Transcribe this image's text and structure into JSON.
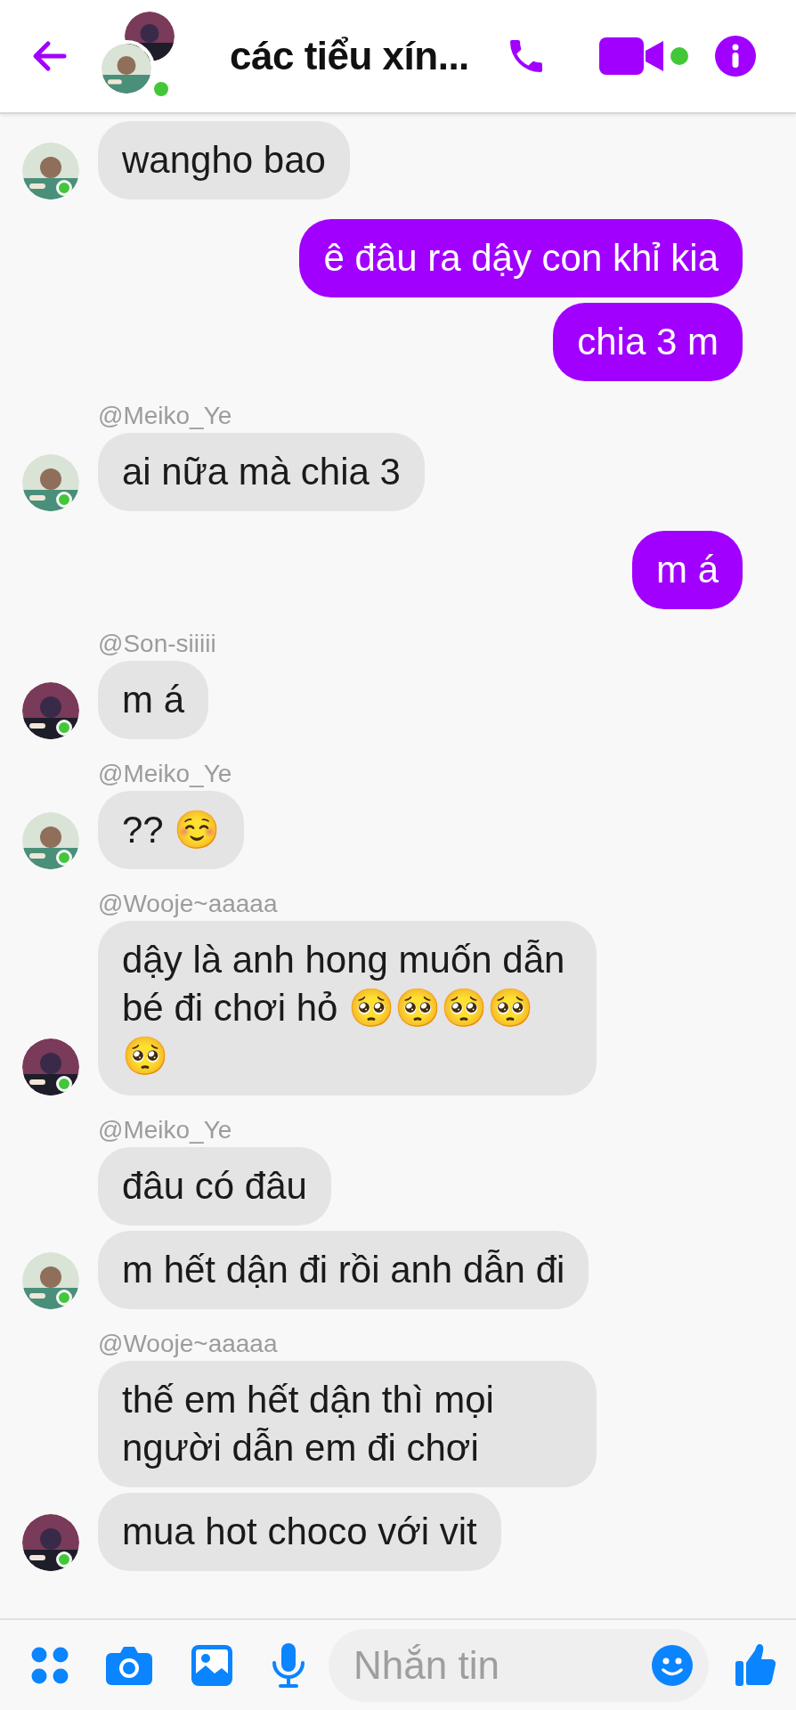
{
  "header": {
    "title": "các tiểu xín...",
    "online": true,
    "video_active": true
  },
  "messages": [
    {
      "kind": "incoming",
      "online": true,
      "bubbles": [
        "wangho bao"
      ]
    },
    {
      "kind": "outgoing",
      "bubbles": [
        "ê đâu ra dậy con khỉ kia",
        "chia 3 m"
      ]
    },
    {
      "kind": "incoming",
      "sender": "@Meiko_Ye",
      "online": true,
      "bubbles": [
        "ai nữa mà chia 3"
      ]
    },
    {
      "kind": "outgoing",
      "bubbles": [
        "m á"
      ]
    },
    {
      "kind": "incoming",
      "sender": "@Son-siiiii",
      "online": true,
      "bubbles": [
        "m á"
      ]
    },
    {
      "kind": "incoming",
      "sender": "@Meiko_Ye",
      "online": true,
      "bubbles": [
        "?? ☺️"
      ]
    },
    {
      "kind": "incoming",
      "sender": "@Wooje~aaaaa",
      "online": true,
      "bubbles": [
        "dậy là anh hong muốn dẫn bé đi chơi hỏ 🥺🥺🥺🥺🥺"
      ]
    },
    {
      "kind": "incoming",
      "sender": "@Meiko_Ye",
      "online": true,
      "bubbles": [
        "đâu có đâu",
        "m hết dận đi rồi anh dẫn đi"
      ]
    },
    {
      "kind": "incoming",
      "sender": "@Wooje~aaaaa",
      "online": true,
      "bubbles": [
        "thế em hết dận thì mọi người dẫn em đi chơi",
        "mua hot choco với vit"
      ]
    }
  ],
  "composer": {
    "placeholder": "Nhắn tin"
  }
}
